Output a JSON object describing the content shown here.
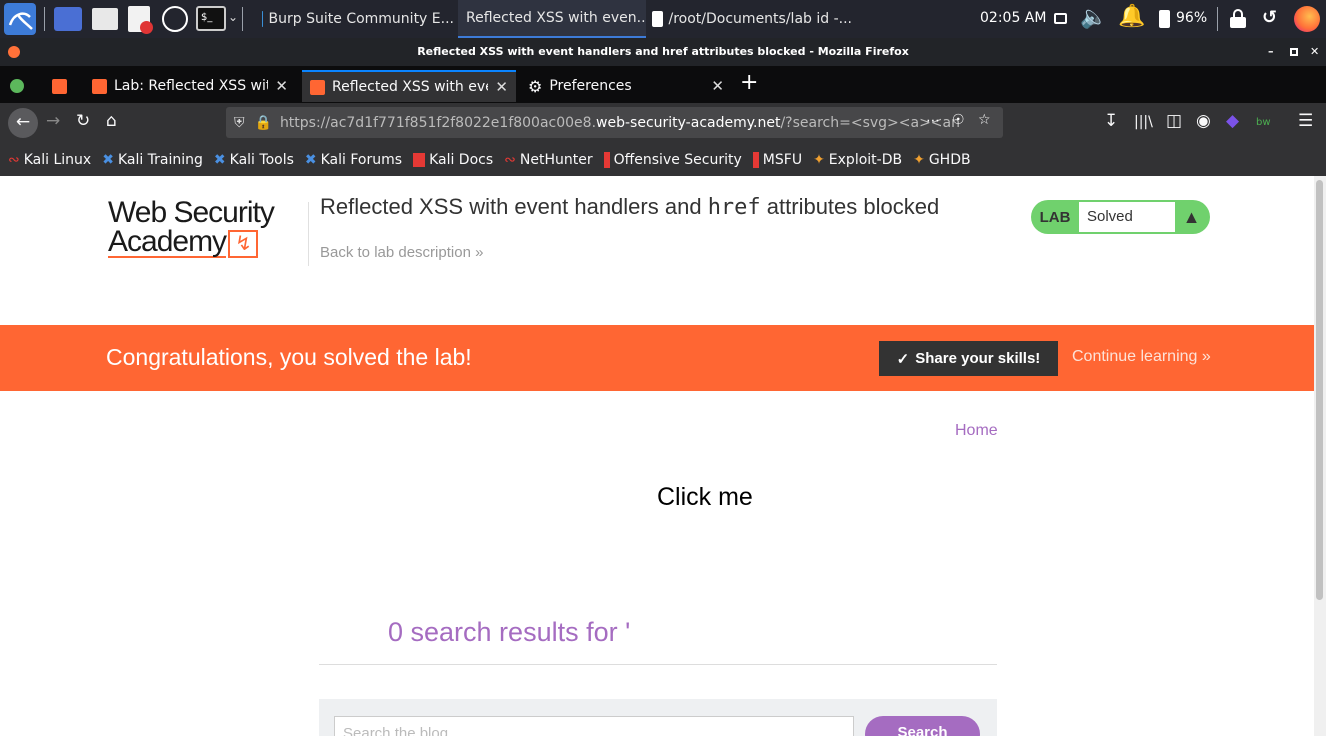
{
  "taskbar": {
    "apps": [
      {
        "label": "Burp Suite Community E..."
      },
      {
        "label": "Reflected XSS with even..."
      },
      {
        "label": "/root/Documents/lab id -..."
      }
    ],
    "time": "02:05 AM",
    "battery": "96%"
  },
  "window": {
    "title": "Reflected XSS with event handlers and href attributes blocked - Mozilla Firefox"
  },
  "tabs": [
    {
      "label": "Lab: Reflected XSS with e"
    },
    {
      "label": "Reflected XSS with event"
    },
    {
      "label": "Preferences"
    }
  ],
  "url": {
    "prefix": "https://ac7d1f771f851f2f8022e1f800ac00e8.",
    "host": "web-security-academy.net",
    "path": "/?search=<svg><a><an"
  },
  "bookmarks": [
    {
      "label": "Kali Linux"
    },
    {
      "label": "Kali Training"
    },
    {
      "label": "Kali Tools"
    },
    {
      "label": "Kali Forums"
    },
    {
      "label": "Kali Docs"
    },
    {
      "label": "NetHunter"
    },
    {
      "label": "Offensive Security"
    },
    {
      "label": "MSFU"
    },
    {
      "label": "Exploit-DB"
    },
    {
      "label": "GHDB"
    }
  ],
  "header": {
    "logo_line1": "Web Security",
    "logo_line2": "Academy",
    "title_part1": "Reflected XSS with event handlers and ",
    "title_code": "href",
    "title_part2": " attributes blocked",
    "back_link": "Back to lab description",
    "lab_badge": "LAB",
    "lab_status": "Solved"
  },
  "banner": {
    "message": "Congratulations, you solved the lab!",
    "share": "Share your skills!",
    "continue": "Continue learning"
  },
  "main": {
    "home": "Home",
    "click_me": "Click me",
    "results": "0 search results for '",
    "search_placeholder": "Search the blog...",
    "search_button": "Search"
  },
  "colors": {
    "banner": "#ff6633",
    "accent_purple": "#a56cc1",
    "lab_green": "#70d16d",
    "active_tab_line": "#0a84ff"
  }
}
